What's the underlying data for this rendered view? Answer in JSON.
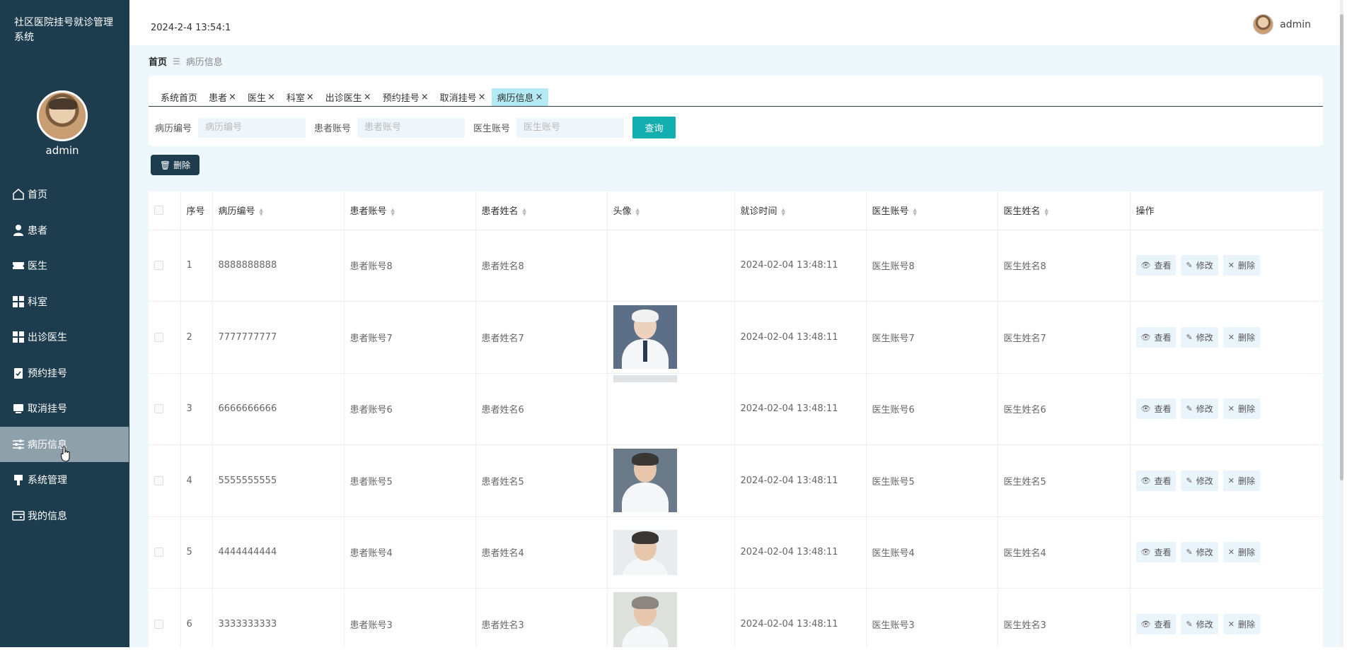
{
  "app": {
    "title": "社区医院挂号就诊管理系统"
  },
  "sidebar": {
    "user": "admin",
    "items": [
      {
        "label": "首页",
        "icon": "home-icon"
      },
      {
        "label": "患者",
        "icon": "user-icon"
      },
      {
        "label": "医生",
        "icon": "ticket-icon"
      },
      {
        "label": "科室",
        "icon": "grid-icon"
      },
      {
        "label": "出诊医生",
        "icon": "grid-icon"
      },
      {
        "label": "预约挂号",
        "icon": "clipboard-icon"
      },
      {
        "label": "取消挂号",
        "icon": "monitor-icon"
      },
      {
        "label": "病历信息",
        "icon": "sliders-icon",
        "active": true
      },
      {
        "label": "系统管理",
        "icon": "flag-icon"
      },
      {
        "label": "我的信息",
        "icon": "wallet-icon"
      }
    ]
  },
  "header": {
    "datetime": "2024-2-4 13:54:1",
    "user": "admin"
  },
  "breadcrumb": {
    "home": "首页",
    "current": "病历信息"
  },
  "tabs": [
    {
      "label": "系统首页",
      "closable": false
    },
    {
      "label": "患者",
      "closable": true
    },
    {
      "label": "医生",
      "closable": true
    },
    {
      "label": "科室",
      "closable": true
    },
    {
      "label": "出诊医生",
      "closable": true
    },
    {
      "label": "预约挂号",
      "closable": true
    },
    {
      "label": "取消挂号",
      "closable": true
    },
    {
      "label": "病历信息",
      "closable": true,
      "active": true
    }
  ],
  "search": {
    "fields": [
      {
        "label": "病历编号",
        "placeholder": "病历编号"
      },
      {
        "label": "患者账号",
        "placeholder": "患者账号"
      },
      {
        "label": "医生账号",
        "placeholder": "医生账号"
      }
    ],
    "button": "查询"
  },
  "toolbar": {
    "delete_label": "删除"
  },
  "table": {
    "columns": [
      "序号",
      "病历编号",
      "患者账号",
      "患者姓名",
      "头像",
      "就诊时间",
      "医生账号",
      "医生姓名",
      "操作"
    ],
    "rows": [
      {
        "index": "1",
        "record_no": "8888888888",
        "patient_account": "患者账号8",
        "patient_name": "患者姓名8",
        "avatar": "none",
        "time": "2024-02-04 13:48:11",
        "doctor_account": "医生账号8",
        "doctor_name": "医生姓名8"
      },
      {
        "index": "2",
        "record_no": "7777777777",
        "patient_account": "患者账号7",
        "patient_name": "患者姓名7",
        "avatar": "photo",
        "time": "2024-02-04 13:48:11",
        "doctor_account": "医生账号7",
        "doctor_name": "医生姓名7"
      },
      {
        "index": "3",
        "record_no": "6666666666",
        "patient_account": "患者账号6",
        "patient_name": "患者姓名6",
        "avatar": "partial",
        "time": "2024-02-04 13:48:11",
        "doctor_account": "医生账号6",
        "doctor_name": "医生姓名6"
      },
      {
        "index": "4",
        "record_no": "5555555555",
        "patient_account": "患者账号5",
        "patient_name": "患者姓名5",
        "avatar": "photo",
        "time": "2024-02-04 13:48:11",
        "doctor_account": "医生账号5",
        "doctor_name": "医生姓名5"
      },
      {
        "index": "5",
        "record_no": "4444444444",
        "patient_account": "患者账号4",
        "patient_name": "患者姓名4",
        "avatar": "photo",
        "time": "2024-02-04 13:48:11",
        "doctor_account": "医生账号4",
        "doctor_name": "医生姓名4"
      },
      {
        "index": "6",
        "record_no": "3333333333",
        "patient_account": "患者账号3",
        "patient_name": "患者姓名3",
        "avatar": "photo",
        "time": "2024-02-04 13:48:11",
        "doctor_account": "医生账号3",
        "doctor_name": "医生姓名3"
      }
    ],
    "actions": {
      "view": "查看",
      "edit": "修改",
      "delete": "删除"
    }
  },
  "colors": {
    "sidebar": "#1d3d4f",
    "accent": "#13aeb0",
    "active_tab": "#b4eaf3",
    "background": "#eef7fc"
  }
}
